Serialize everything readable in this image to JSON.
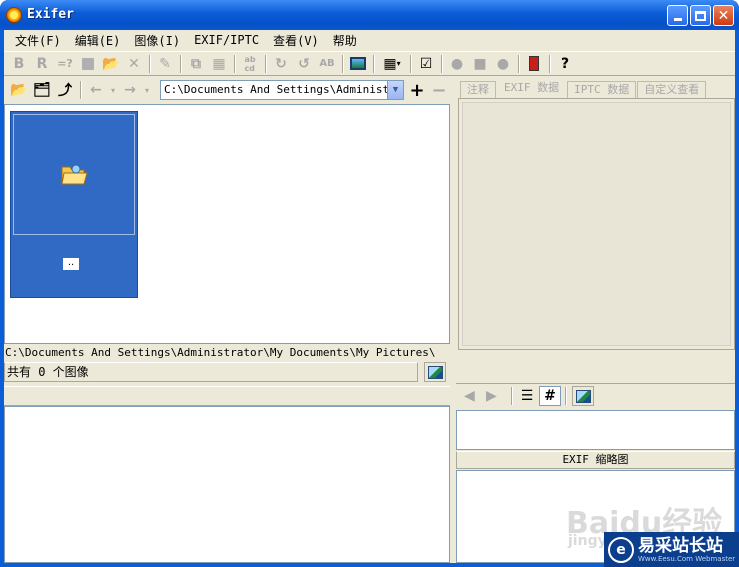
{
  "window": {
    "title": "Exifer"
  },
  "menu": [
    "文件(F)",
    "编辑(E)",
    "图像(I)",
    "EXIF/IPTC",
    "查看(V)",
    "帮助"
  ],
  "toolbar": {
    "bold_b": "B",
    "bold_r": "R",
    "eq": "=?",
    "help": "?"
  },
  "path_combo": {
    "value": "C:\\Documents And Settings\\Administrator\\My Documents"
  },
  "thumbnail": {
    "label": ".."
  },
  "current_path": "C:\\Documents And Settings\\Administrator\\My Documents\\My Pictures\\",
  "status": {
    "count_text": "共有 0 个图像"
  },
  "tabs": [
    "注释",
    "EXIF 数据",
    "IPTC 数据",
    "自定义查看"
  ],
  "thumb_header": "EXIF 缩略图",
  "watermark": {
    "baidu": "Baidu经验",
    "jingyan": "jingyan"
  },
  "brand": {
    "name": "易采站长站",
    "url": "Www.Eesu.Com Webmaster"
  }
}
